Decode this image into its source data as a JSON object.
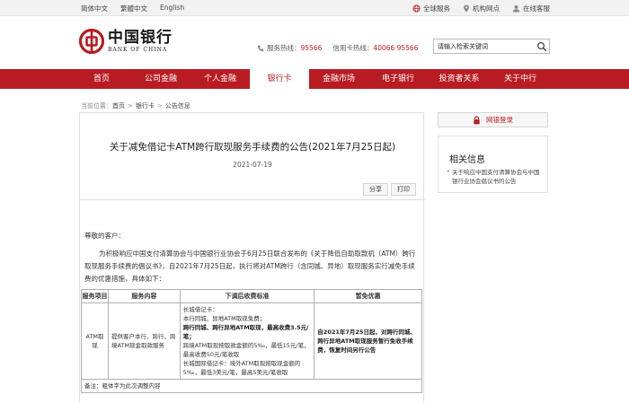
{
  "topbar": {
    "langs": [
      "简体中文",
      "繁體中文",
      "English"
    ],
    "links": [
      {
        "label": "全球服务",
        "icon": "globe-icon"
      },
      {
        "label": "机构网点",
        "icon": "location-pin-icon"
      },
      {
        "label": "在线客服",
        "icon": "user-icon"
      }
    ]
  },
  "logo": {
    "cn": "中国银行",
    "en": "BANK OF CHINA"
  },
  "hotlines": {
    "service_label": "服务热线：",
    "service_number": "95566",
    "card_label": "信用卡热线：",
    "card_number": "40066 95566"
  },
  "search": {
    "placeholder": "请输入检索关键词"
  },
  "nav": {
    "items": [
      "首页",
      "公司金融",
      "个人金融",
      "银行卡",
      "金融市场",
      "电子银行",
      "投资者关系",
      "关于中行"
    ],
    "active_index": 3
  },
  "breadcrumb": {
    "label": "当前位置：",
    "items": [
      "首页",
      "银行卡",
      "公告信息"
    ]
  },
  "article": {
    "title": "关于减免借记卡ATM跨行取现服务手续费的公告(2021年7月25日起)",
    "date": "2021-07-19",
    "share": "分享",
    "print": "打印",
    "greeting": "尊敬的客户：",
    "paragraph": "为积极响应中国支付清算协会与中国银行业协会于6月25日联合发布的《关于降低自助取款机（ATM）跨行取现服务手续费的倡议书》，自2021年7月25日起，执行将对ATM跨行（含同城、异地）取现服务实行减免手续费的优惠措施，具体如下："
  },
  "table": {
    "headers": [
      "服务项目",
      "服务内容",
      "下调后收费标准",
      "暂免优惠"
    ],
    "item": "ATM取现",
    "content": "提供客户本行、跨行、跨境ATM现金取款服务",
    "std": {
      "l1": "长城借记卡：",
      "l2": "本行同城、异地ATM取现免费；",
      "l3": "跨行同城、跨行异地ATM取现，最高收费3.5元/笔；",
      "l4": "跨境ATM取现按取款金额的5‰，最低15元/笔，最高收费50元/笔收取",
      "l5": "长城国际借记卡：境外ATM取现按取现金额的5‰，最低3美元/笔，最高5美元/笔收取"
    },
    "promo": "自2021年7月25日起，对跨行同城、跨行异地ATM取现服务暂行免收手续费，恢复时间另行公告",
    "note": "备注：粗体字为此次调整内容"
  },
  "sidebar": {
    "login": "网银登录",
    "related_title": "相关信息",
    "related_link": "关于响应中国支付清算协会与中国银行业协会倡议书的公告"
  },
  "colors": {
    "brand_red": "#b81c22"
  }
}
